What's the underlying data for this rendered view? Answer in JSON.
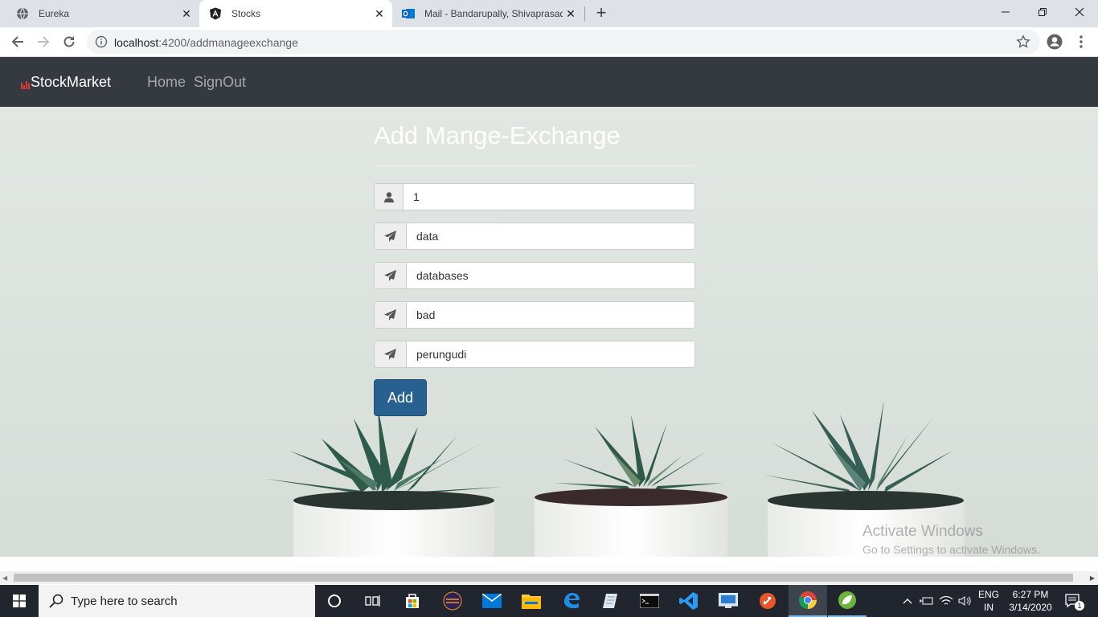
{
  "browser": {
    "tabs": [
      {
        "title": "Eureka",
        "icon": "globe-icon"
      },
      {
        "title": "Stocks",
        "icon": "angular-icon"
      },
      {
        "title": "Mail - Bandarupally, Shivaprasad",
        "icon": "outlook-icon"
      }
    ],
    "address": {
      "host": "localhost",
      "path": ":4200/addmanageexchange"
    }
  },
  "navbar": {
    "brand": "StockMarket",
    "links": [
      "Home",
      "SignOut"
    ]
  },
  "form": {
    "title": "Add Mange-Exchange",
    "fields": [
      {
        "icon": "user-icon",
        "value": "1"
      },
      {
        "icon": "paper-plane-icon",
        "value": "data"
      },
      {
        "icon": "paper-plane-icon",
        "value": "databases"
      },
      {
        "icon": "paper-plane-icon",
        "value": "bad"
      },
      {
        "icon": "paper-plane-icon",
        "value": "perungudi"
      }
    ],
    "submit_label": "Add"
  },
  "watermark": {
    "line1": "Activate Windows",
    "line2": "Go to Settings to activate Windows."
  },
  "taskbar": {
    "search_placeholder": "Type here to search",
    "language": "ENG",
    "region": "IN",
    "time": "6:27 PM",
    "date": "3/14/2020",
    "notification_count": "1"
  },
  "colors": {
    "navbar_bg": "#343a40",
    "button_primary": "#286090",
    "taskbar_bg": "#21262e"
  }
}
